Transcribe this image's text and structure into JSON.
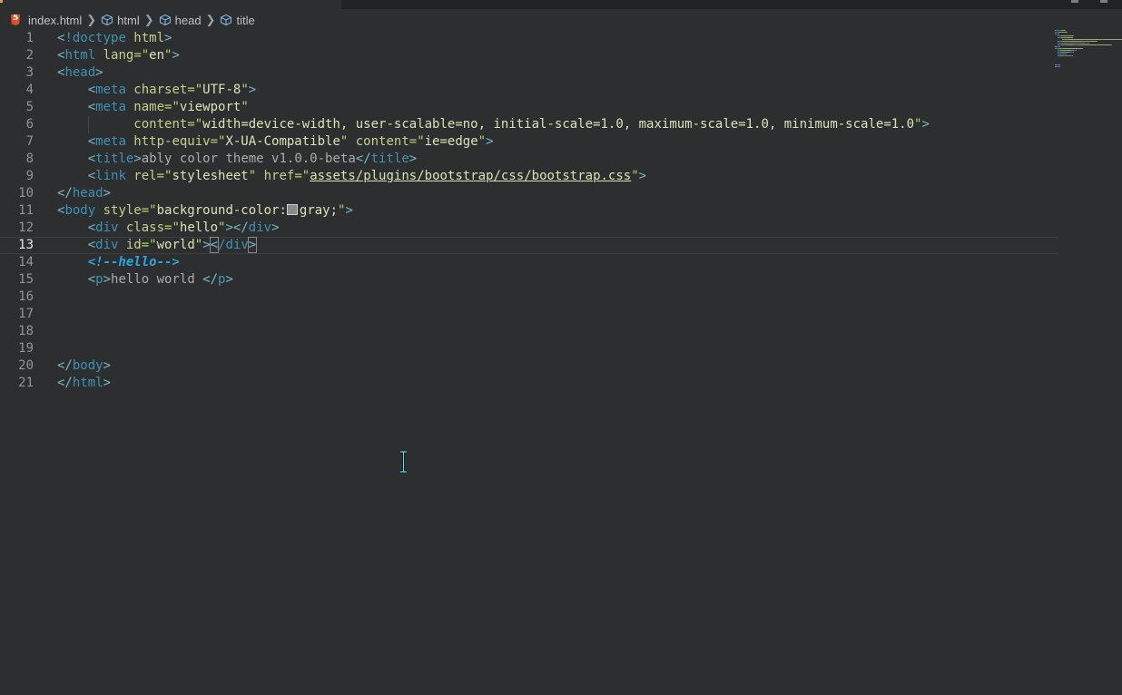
{
  "breadcrumb": {
    "file": "index.html",
    "items": [
      "html",
      "head",
      "title"
    ]
  },
  "lines": [
    {
      "n": "1",
      "tokens": [
        {
          "t": "<",
          "c": "punc"
        },
        {
          "t": "!doctype",
          "c": "doc"
        },
        {
          "t": " html",
          "c": "attr"
        },
        {
          "t": ">",
          "c": "punc"
        }
      ]
    },
    {
      "n": "2",
      "tokens": [
        {
          "t": "<",
          "c": "punc"
        },
        {
          "t": "html",
          "c": "tag"
        },
        {
          "t": " lang",
          "c": "attr"
        },
        {
          "t": "=\"",
          "c": "str"
        },
        {
          "t": "en",
          "c": "sv"
        },
        {
          "t": "\"",
          "c": "str"
        },
        {
          "t": ">",
          "c": "punc"
        }
      ]
    },
    {
      "n": "3",
      "tokens": [
        {
          "t": "<",
          "c": "punc"
        },
        {
          "t": "head",
          "c": "tag"
        },
        {
          "t": ">",
          "c": "punc"
        }
      ]
    },
    {
      "n": "4",
      "tokens": [
        {
          "t": "    "
        },
        {
          "t": "<",
          "c": "punc"
        },
        {
          "t": "meta",
          "c": "tag"
        },
        {
          "t": " charset",
          "c": "attr"
        },
        {
          "t": "=\"",
          "c": "str"
        },
        {
          "t": "UTF-8",
          "c": "sv"
        },
        {
          "t": "\"",
          "c": "str"
        },
        {
          "t": ">",
          "c": "punc"
        }
      ]
    },
    {
      "n": "5",
      "tokens": [
        {
          "t": "    "
        },
        {
          "t": "<",
          "c": "punc"
        },
        {
          "t": "meta",
          "c": "tag"
        },
        {
          "t": " name",
          "c": "attr"
        },
        {
          "t": "=\"",
          "c": "str"
        },
        {
          "t": "viewport",
          "c": "sv"
        },
        {
          "t": "\"",
          "c": "str"
        }
      ]
    },
    {
      "n": "6",
      "tokens": [
        {
          "t": "          "
        },
        {
          "t": "content",
          "c": "attr"
        },
        {
          "t": "=\"",
          "c": "str"
        },
        {
          "t": "width=device-width, user-scalable=no, initial-scale=1.0, maximum-scale=1.0, minimum-scale=1.0",
          "c": "sv"
        },
        {
          "t": "\"",
          "c": "str"
        },
        {
          "t": ">",
          "c": "punc"
        }
      ]
    },
    {
      "n": "7",
      "tokens": [
        {
          "t": "    "
        },
        {
          "t": "<",
          "c": "punc"
        },
        {
          "t": "meta",
          "c": "tag"
        },
        {
          "t": " http-equiv",
          "c": "attr"
        },
        {
          "t": "=\"",
          "c": "str"
        },
        {
          "t": "X-UA-Compatible",
          "c": "sv"
        },
        {
          "t": "\"",
          "c": "str"
        },
        {
          "t": " content",
          "c": "attr"
        },
        {
          "t": "=\"",
          "c": "str"
        },
        {
          "t": "ie=edge",
          "c": "sv"
        },
        {
          "t": "\"",
          "c": "str"
        },
        {
          "t": ">",
          "c": "punc"
        }
      ]
    },
    {
      "n": "8",
      "tokens": [
        {
          "t": "    "
        },
        {
          "t": "<",
          "c": "punc"
        },
        {
          "t": "title",
          "c": "tag"
        },
        {
          "t": ">",
          "c": "punc"
        },
        {
          "t": "ably color theme v1.0.0-beta",
          "c": "plain"
        },
        {
          "t": "</",
          "c": "punc"
        },
        {
          "t": "title",
          "c": "tag"
        },
        {
          "t": ">",
          "c": "punc"
        }
      ]
    },
    {
      "n": "9",
      "tokens": [
        {
          "t": "    "
        },
        {
          "t": "<",
          "c": "punc"
        },
        {
          "t": "link",
          "c": "tag"
        },
        {
          "t": " rel",
          "c": "attr"
        },
        {
          "t": "=\"",
          "c": "str"
        },
        {
          "t": "stylesheet",
          "c": "sv"
        },
        {
          "t": "\"",
          "c": "str"
        },
        {
          "t": " href",
          "c": "attr"
        },
        {
          "t": "=\"",
          "c": "str"
        },
        {
          "t": "assets/plugins/bootstrap/css/bootstrap.css",
          "c": "sv u"
        },
        {
          "t": "\"",
          "c": "str"
        },
        {
          "t": ">",
          "c": "punc"
        }
      ]
    },
    {
      "n": "10",
      "tokens": [
        {
          "t": "</",
          "c": "punc"
        },
        {
          "t": "head",
          "c": "tag"
        },
        {
          "t": ">",
          "c": "punc"
        }
      ]
    },
    {
      "n": "11",
      "tokens": [
        {
          "t": "<",
          "c": "punc"
        },
        {
          "t": "body",
          "c": "tag"
        },
        {
          "t": " style",
          "c": "attr"
        },
        {
          "t": "=\"",
          "c": "str"
        },
        {
          "t": "background-color:",
          "c": "sv"
        },
        {
          "t": "",
          "c": "swatch"
        },
        {
          "t": "gray;",
          "c": "sv"
        },
        {
          "t": "\"",
          "c": "str"
        },
        {
          "t": ">",
          "c": "punc"
        }
      ]
    },
    {
      "n": "12",
      "tokens": [
        {
          "t": "    "
        },
        {
          "t": "<",
          "c": "punc"
        },
        {
          "t": "div",
          "c": "tag"
        },
        {
          "t": " class",
          "c": "attr"
        },
        {
          "t": "=\"",
          "c": "str"
        },
        {
          "t": "hello",
          "c": "sv"
        },
        {
          "t": "\"",
          "c": "str"
        },
        {
          "t": ">",
          "c": "punc"
        },
        {
          "t": "</",
          "c": "punc"
        },
        {
          "t": "div",
          "c": "tag"
        },
        {
          "t": ">",
          "c": "punc"
        }
      ]
    },
    {
      "n": "13",
      "current": true,
      "tokens": [
        {
          "t": "    "
        },
        {
          "t": "<",
          "c": "punc"
        },
        {
          "t": "div",
          "c": "tag"
        },
        {
          "t": " id",
          "c": "attr"
        },
        {
          "t": "=\"",
          "c": "str"
        },
        {
          "t": "world",
          "c": "sv"
        },
        {
          "t": "\"",
          "c": "str"
        },
        {
          "t": ">",
          "c": "punc"
        },
        {
          "t": "<",
          "c": "punc bracket-hl"
        },
        {
          "t": "/div",
          "c": "tag"
        },
        {
          "t": ">",
          "c": "punc bracket-hl"
        }
      ]
    },
    {
      "n": "14",
      "tokens": [
        {
          "t": "    "
        },
        {
          "t": "<!--hello-->",
          "c": "comment"
        }
      ]
    },
    {
      "n": "15",
      "tokens": [
        {
          "t": "    "
        },
        {
          "t": "<",
          "c": "punc"
        },
        {
          "t": "p",
          "c": "tag"
        },
        {
          "t": ">",
          "c": "punc"
        },
        {
          "t": "hello world ",
          "c": "plain"
        },
        {
          "t": "</",
          "c": "punc"
        },
        {
          "t": "p",
          "c": "tag"
        },
        {
          "t": ">",
          "c": "punc"
        }
      ]
    },
    {
      "n": "16",
      "tokens": []
    },
    {
      "n": "17",
      "tokens": []
    },
    {
      "n": "18",
      "tokens": []
    },
    {
      "n": "19",
      "tokens": []
    },
    {
      "n": "20",
      "tokens": [
        {
          "t": "</",
          "c": "punc"
        },
        {
          "t": "body",
          "c": "tag"
        },
        {
          "t": ">",
          "c": "punc"
        }
      ]
    },
    {
      "n": "21",
      "tokens": [
        {
          "t": "</",
          "c": "punc"
        },
        {
          "t": "html",
          "c": "tag"
        },
        {
          "t": ">",
          "c": "punc"
        }
      ]
    }
  ],
  "colors": {
    "background": "#2c2e2f",
    "tag": "#3e92b8",
    "attribute": "#c6d08c",
    "string": "#b2d86a",
    "comment": "#29a8e0",
    "html5_icon": "#e44d26"
  },
  "icons": {
    "file": "html5-icon",
    "symbol": "cube-icon",
    "separator": "chevron-right-icon",
    "mouse": "text-cursor-icon"
  }
}
